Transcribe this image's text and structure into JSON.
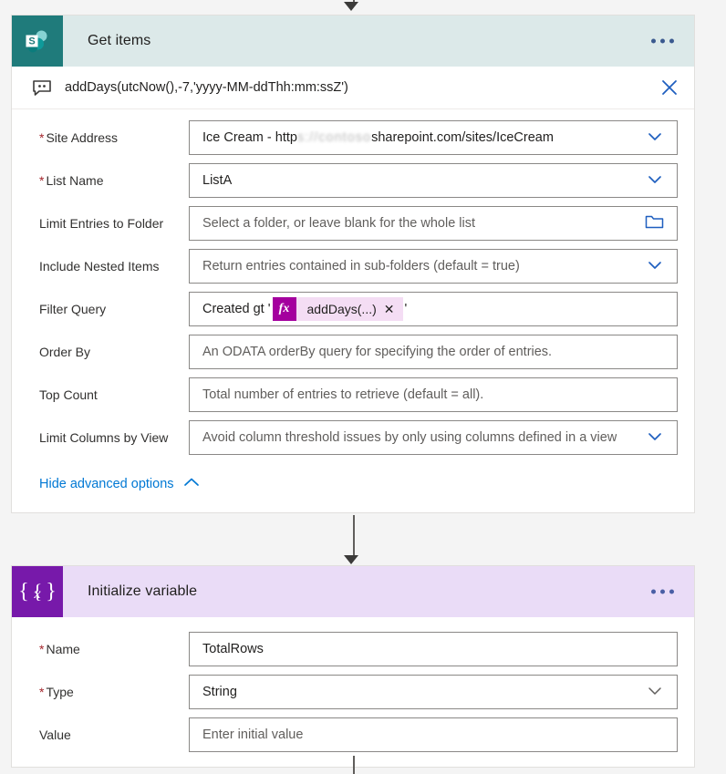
{
  "flow": {
    "connectors": [
      {
        "name": "connector-top"
      },
      {
        "name": "connector-middle"
      },
      {
        "name": "connector-bottom"
      }
    ]
  },
  "get_items_card": {
    "icon_name": "sharepoint-icon",
    "icon_letter": "S",
    "title": "Get items",
    "header_bg": "#dce9e9",
    "icon_bg": "#1f7b7b",
    "more_label": "•••",
    "comment": {
      "icon_name": "comment-icon",
      "text": "addDays(utcNow(),-7,'yyyy-MM-ddThh:mm:ssZ')",
      "close_label": "✕"
    },
    "fields": [
      {
        "label": "Site Address",
        "required": true,
        "value_prefix": "Ice Cream - http",
        "value_redacted": "s://contoso",
        "value_suffix": "sharepoint.com/sites/IceCream",
        "placeholder": "",
        "control": "dropdown"
      },
      {
        "label": "List Name",
        "required": true,
        "value": "ListA",
        "placeholder": "",
        "control": "dropdown"
      },
      {
        "label": "Limit Entries to Folder",
        "required": false,
        "value": "",
        "placeholder": "Select a folder, or leave blank for the whole list",
        "control": "folder"
      },
      {
        "label": "Include Nested Items",
        "required": false,
        "value": "",
        "placeholder": "Return entries contained in sub-folders (default = true)",
        "control": "dropdown"
      },
      {
        "label": "Filter Query",
        "required": false,
        "value": "",
        "placeholder": "",
        "control": "token",
        "token_prefix": "Created gt '",
        "token_fx": "fx",
        "token_label": "addDays(...)",
        "token_close": "✕",
        "token_suffix": "'"
      },
      {
        "label": "Order By",
        "required": false,
        "value": "",
        "placeholder": "An ODATA orderBy query for specifying the order of entries.",
        "control": "none"
      },
      {
        "label": "Top Count",
        "required": false,
        "value": "",
        "placeholder": "Total number of entries to retrieve (default = all).",
        "control": "none"
      },
      {
        "label": "Limit Columns by View",
        "required": false,
        "value": "",
        "placeholder": "Avoid column threshold issues by only using columns defined in a view",
        "control": "dropdown"
      }
    ],
    "advanced_toggle": "Hide advanced options"
  },
  "initialize_variable_card": {
    "icon_name": "variable-icon",
    "icon_glyph": "{x}",
    "title": "Initialize variable",
    "header_bg": "#eadcf7",
    "icon_bg": "#7719aa",
    "more_label": "•••",
    "fields": [
      {
        "label": "Name",
        "required": true,
        "value": "TotalRows",
        "placeholder": "",
        "control": "none"
      },
      {
        "label": "Type",
        "required": true,
        "value": "String",
        "placeholder": "",
        "control": "dropdown"
      },
      {
        "label": "Value",
        "required": false,
        "value": "",
        "placeholder": "Enter initial value",
        "control": "none"
      }
    ]
  },
  "colors": {
    "accent_blue": "#0078d4",
    "required_red": "#a4262c",
    "sharepoint_teal": "#1f7b7b",
    "variable_purple": "#7719aa",
    "token_magenta": "#a4009e"
  }
}
